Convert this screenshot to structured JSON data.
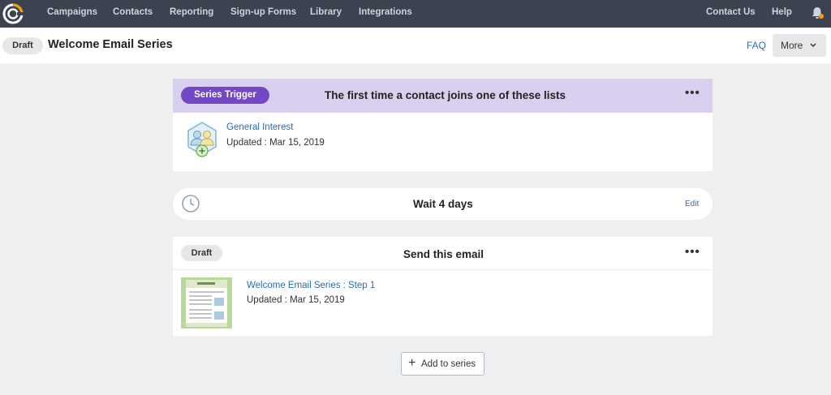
{
  "nav": {
    "items": [
      "Campaigns",
      "Contacts",
      "Reporting",
      "Sign-up Forms",
      "Library",
      "Integrations"
    ],
    "contact_us": "Contact Us",
    "help": "Help",
    "colors": {
      "bar": "#3b4350",
      "logo_accent": "#f39c12"
    }
  },
  "header": {
    "status": "Draft",
    "title": "Welcome Email Series",
    "faq": "FAQ",
    "more": "More"
  },
  "trigger": {
    "badge": "Series Trigger",
    "heading": "The first time a contact joins one of these lists",
    "list_name": "General Interest",
    "updated": "Updated : Mar 15, 2019",
    "accent": "#7448c4"
  },
  "wait": {
    "label": "Wait 4 days",
    "edit": "Edit"
  },
  "email": {
    "status": "Draft",
    "heading": "Send this email",
    "name": "Welcome Email Series : Step 1",
    "updated": "Updated : Mar 15, 2019"
  },
  "add_button": "Add to series"
}
